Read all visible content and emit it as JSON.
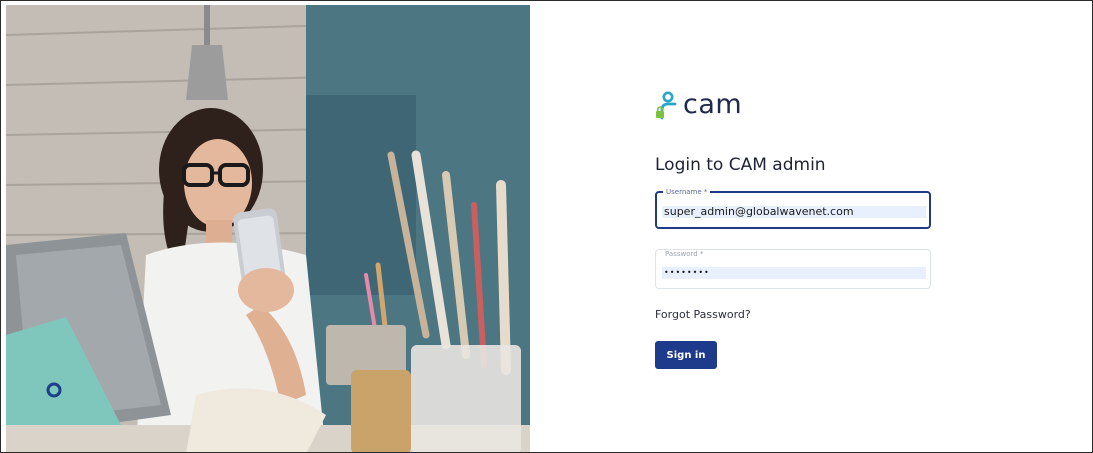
{
  "brand": {
    "name": "cam",
    "accent_color": "#1e3a8a",
    "logo_icon": "user-lock-icon"
  },
  "login": {
    "title": "Login to CAM admin",
    "username": {
      "label": "Username *",
      "value": "super_admin@globalwavenet.com"
    },
    "password": {
      "label": "Password *",
      "value": "••••••••"
    },
    "forgot_label": "Forgot Password?",
    "signin_label": "Sign in"
  },
  "photo": {
    "subject": "woman-with-phone-and-laptop-photo"
  }
}
